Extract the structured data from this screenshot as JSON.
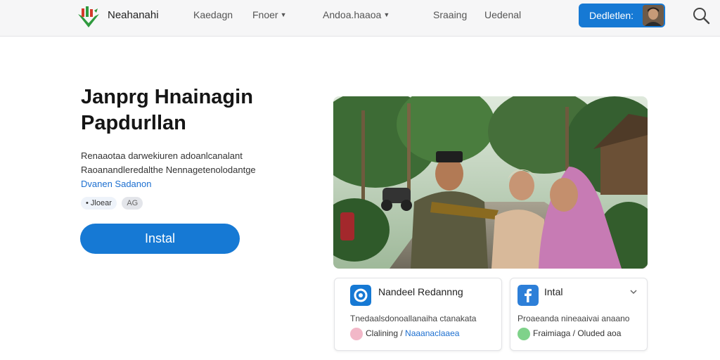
{
  "nav": {
    "brand": "Neahanahi",
    "links": [
      {
        "label": "Kaedagn",
        "dropdown": false
      },
      {
        "label": "Fnoer",
        "dropdown": true
      },
      {
        "label": "Andoa.haaoa",
        "dropdown": true
      },
      {
        "label": "Sraaing",
        "dropdown": false
      },
      {
        "label": "Uedenal",
        "dropdown": false
      }
    ],
    "cta_label": "Dedletlen:",
    "icons": {
      "search": "search-icon",
      "logo": "brand-logo-icon",
      "avatar": "user-avatar"
    }
  },
  "hero": {
    "title_line1": "Janprg Hnainagin",
    "title_line2": "Papdurllan",
    "desc_line1": "Renaaotaa darwekiuren adoanlcanalant",
    "desc_line2": "Raoanandleredalthe Nennagetenolodantge",
    "link": "Dvanen Sadanon",
    "chip1": "• Jloear",
    "chip2": "AG",
    "install_label": "Instal"
  },
  "cards": [
    {
      "title": "Nandeel Redannng",
      "text": "Tnedaalsdonoallanaiha ctanakata",
      "meta_prefix": "Clalining / ",
      "meta_link": "Naaanaclaaea",
      "icon": "circle-badge-icon",
      "emoji": "smiley-pink-icon"
    },
    {
      "title": "Intal",
      "text": "Proaeanda nineaaivai anaano",
      "meta_prefix": "Fraimiaga / Oluded aoa",
      "meta_link": "",
      "icon": "facebook-icon",
      "emoji": "smiley-green-icon"
    }
  ],
  "colors": {
    "accent": "#1679d4",
    "nav_bg": "#f6f6f7"
  }
}
